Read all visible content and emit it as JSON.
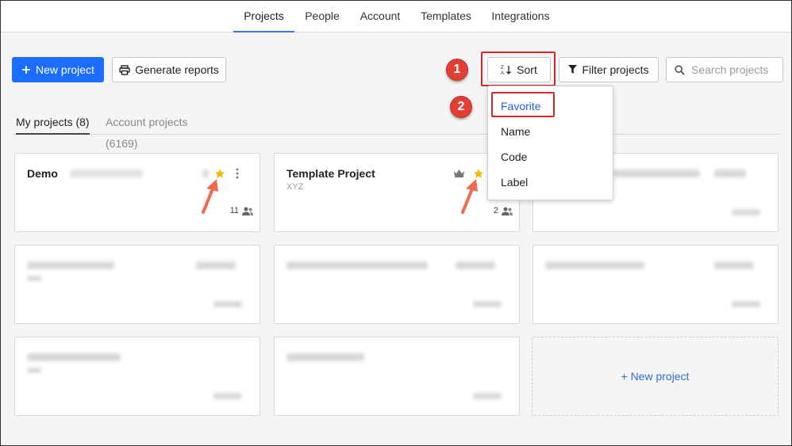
{
  "nav": {
    "tabs": [
      {
        "label": "Projects",
        "active": true
      },
      {
        "label": "People"
      },
      {
        "label": "Account"
      },
      {
        "label": "Templates"
      },
      {
        "label": "Integrations"
      }
    ]
  },
  "toolbar": {
    "new_project": "New project",
    "generate_reports": "Generate reports",
    "sort": "Sort",
    "filter": "Filter projects",
    "search_placeholder": "Search projects"
  },
  "callouts": {
    "one": "1",
    "two": "2"
  },
  "sort_menu": {
    "options": [
      "Favorite",
      "Name",
      "Code",
      "Label"
    ],
    "selected": "Favorite"
  },
  "project_tabs": {
    "mine": "My projects (8)",
    "account": "Account projects (6169)"
  },
  "cards": {
    "demo": {
      "title": "Demo",
      "count": "11"
    },
    "template": {
      "title": "Template Project",
      "code": "XYZ",
      "count": "2"
    }
  },
  "new_project_card": "+ New project",
  "colors": {
    "primary": "#1a6dff",
    "accent_link": "#2461d6",
    "callout_red": "#d9262c",
    "star": "#f5b800"
  }
}
